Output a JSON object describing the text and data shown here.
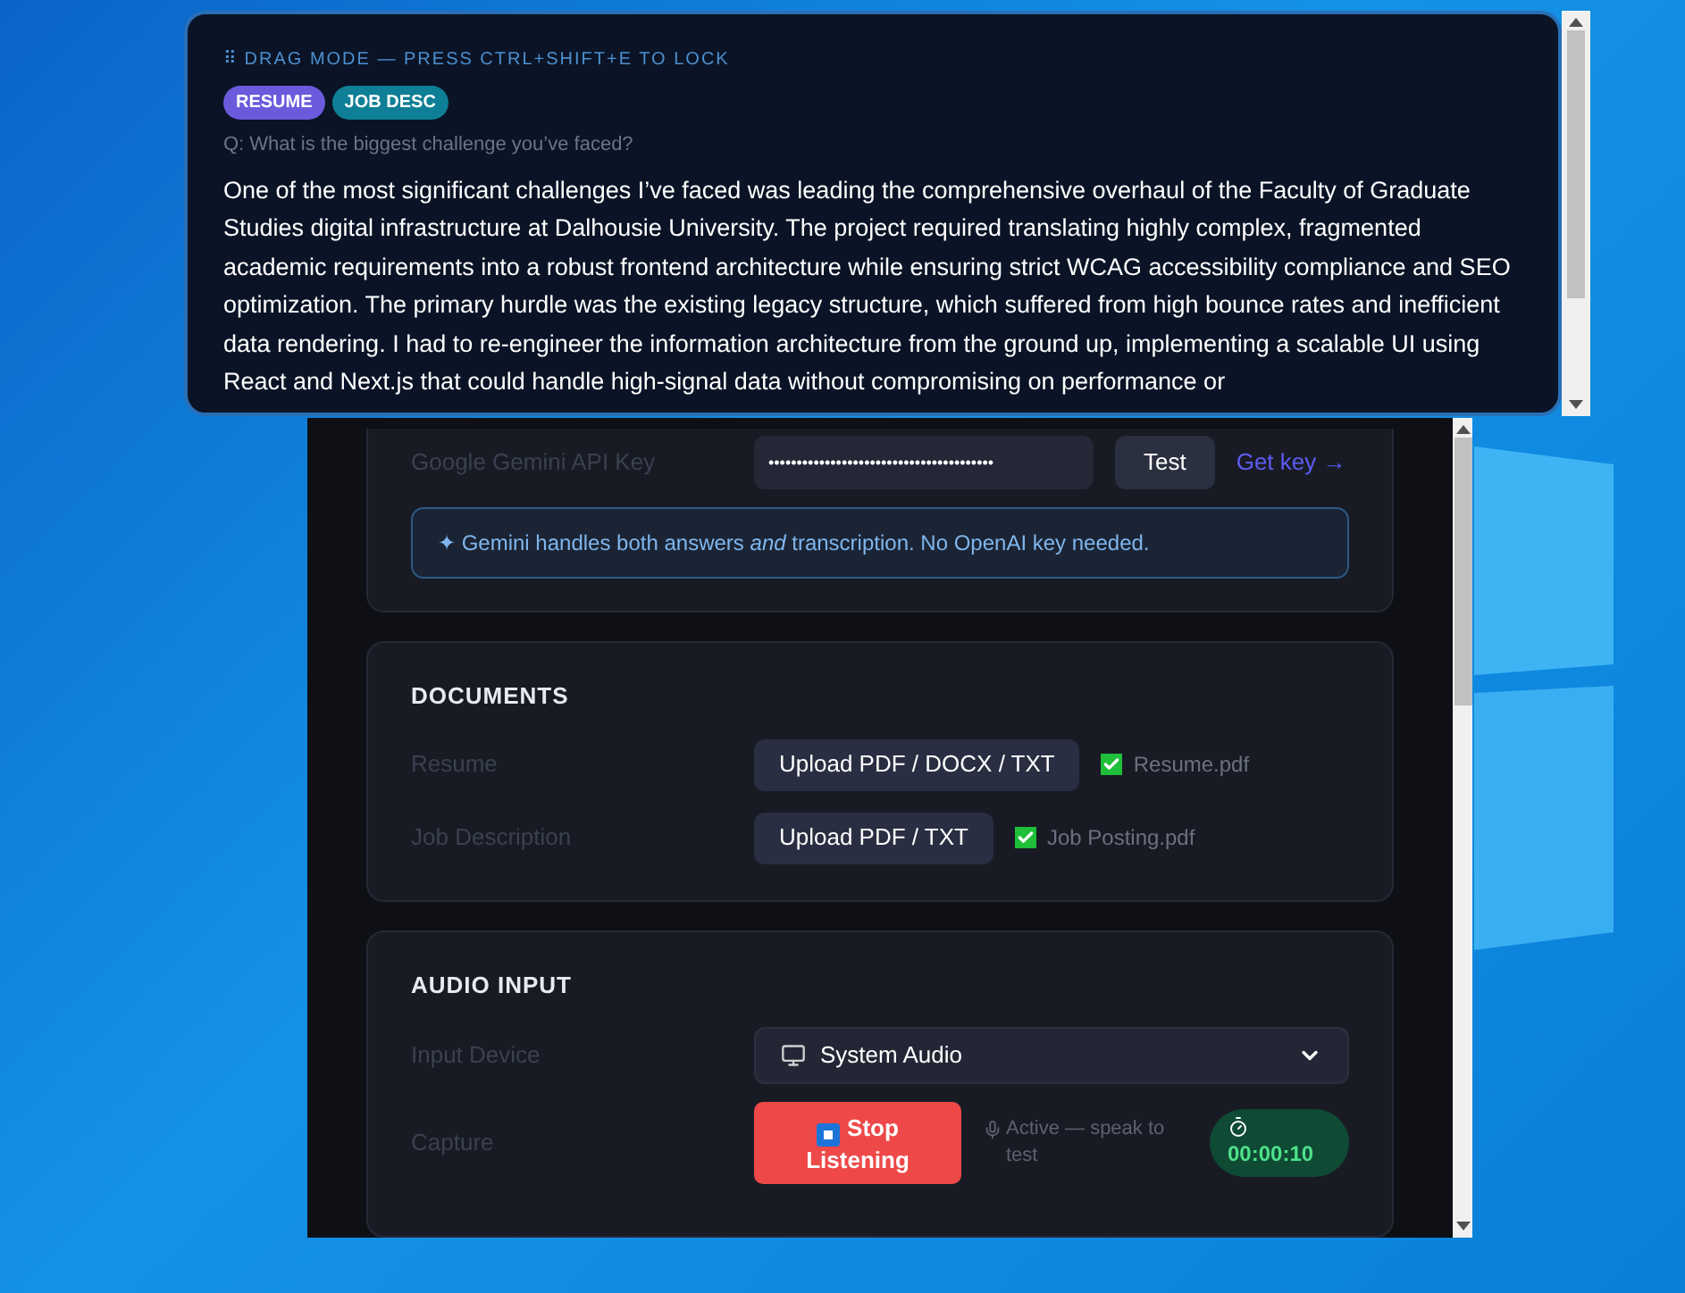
{
  "overlay": {
    "drag_hint": "⠿ DRAG MODE — PRESS CTRL+SHIFT+E TO LOCK",
    "tags": [
      {
        "label": "RESUME",
        "color": "#6b5bdc"
      },
      {
        "label": "JOB DESC",
        "color": "#0e7f96"
      }
    ],
    "question": "Q: What is the biggest challenge you’ve faced?",
    "answer": "One of the most significant challenges I’ve faced was leading the comprehensive overhaul of the Faculty of Graduate Studies digital infrastructure at Dalhousie University. The project required translating highly complex, fragmented academic requirements into a robust frontend architecture while ensuring strict WCAG accessibility compliance and SEO optimization. The primary hurdle was the existing legacy structure, which suffered from high bounce rates and inefficient data rendering. I had to re-engineer the information architecture from the ground up, implementing a scalable UI using React and Next.js that could handle high-signal data without compromising on performance or"
  },
  "settings": {
    "api_row": {
      "label": "Google Gemini API Key",
      "key_value": "••••••••••••••••••••••••••••••••••••••••",
      "test_button": "Test",
      "link": "Get key →"
    },
    "info_note": "✦ Gemini handles both answers *and* transcription. No OpenAI key needed.",
    "documents": {
      "title": "DOCUMENTS",
      "rows": [
        {
          "label": "Resume",
          "button": "Upload PDF / DOCX / TXT",
          "file": "Resume.pdf",
          "checked": true
        },
        {
          "label": "Job Description",
          "button": "Upload PDF / TXT",
          "file": "Job Posting.pdf",
          "checked": true
        }
      ]
    },
    "audio": {
      "title": "AUDIO INPUT",
      "device": {
        "label": "Input Device",
        "value": "System Audio"
      },
      "capture": {
        "label": "Capture",
        "button": "Stop Listening",
        "status": "Active — speak to test",
        "timer": "00:00:10"
      }
    }
  }
}
